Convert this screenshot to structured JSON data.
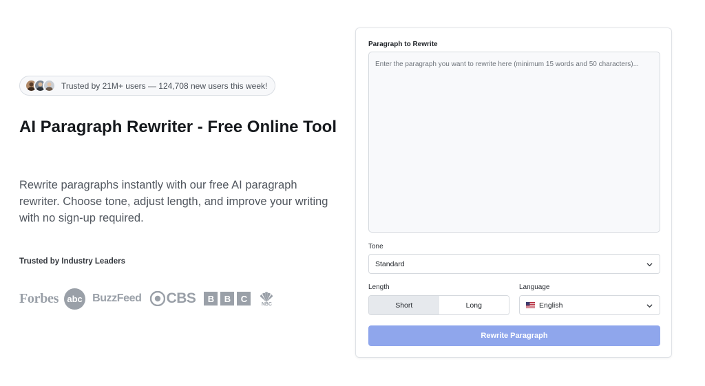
{
  "hero": {
    "trust_text": "Trusted by 21M+ users — 124,708 new users this week!",
    "title": "AI Paragraph Rewriter - Free Online Tool",
    "subtitle": "Rewrite paragraphs instantly with our free AI paragraph rewriter. Choose tone, adjust length, and improve your writing with no sign-up required.",
    "leaders_label": "Trusted by Industry Leaders",
    "logos": {
      "forbes": "Forbes",
      "abc": "abc",
      "buzzfeed": "BuzzFeed",
      "cbs": "CBS",
      "bbc": [
        "B",
        "B",
        "C"
      ],
      "nbc": "NBC"
    }
  },
  "form": {
    "paragraph_label": "Paragraph to Rewrite",
    "paragraph_value": "",
    "paragraph_placeholder": "Enter the paragraph you want to rewrite here (minimum 15 words and 50 characters)...",
    "tone_label": "Tone",
    "tone_value": "Standard",
    "length_label": "Length",
    "length_options": [
      "Short",
      "Long"
    ],
    "length_selected": "Short",
    "language_label": "Language",
    "language_value": "English",
    "submit_label": "Rewrite Paragraph"
  },
  "icons": {
    "avatars": [
      "avatar-1",
      "avatar-2",
      "avatar-3"
    ],
    "tone_chevron": "chevron-down-icon",
    "language_chevron": "chevron-down-icon",
    "language_flag": "us-flag-icon"
  },
  "colors": {
    "button": "#8fa6ec",
    "logo_gray": "#9aa0a8",
    "active_toggle": "#e6e9ed"
  }
}
